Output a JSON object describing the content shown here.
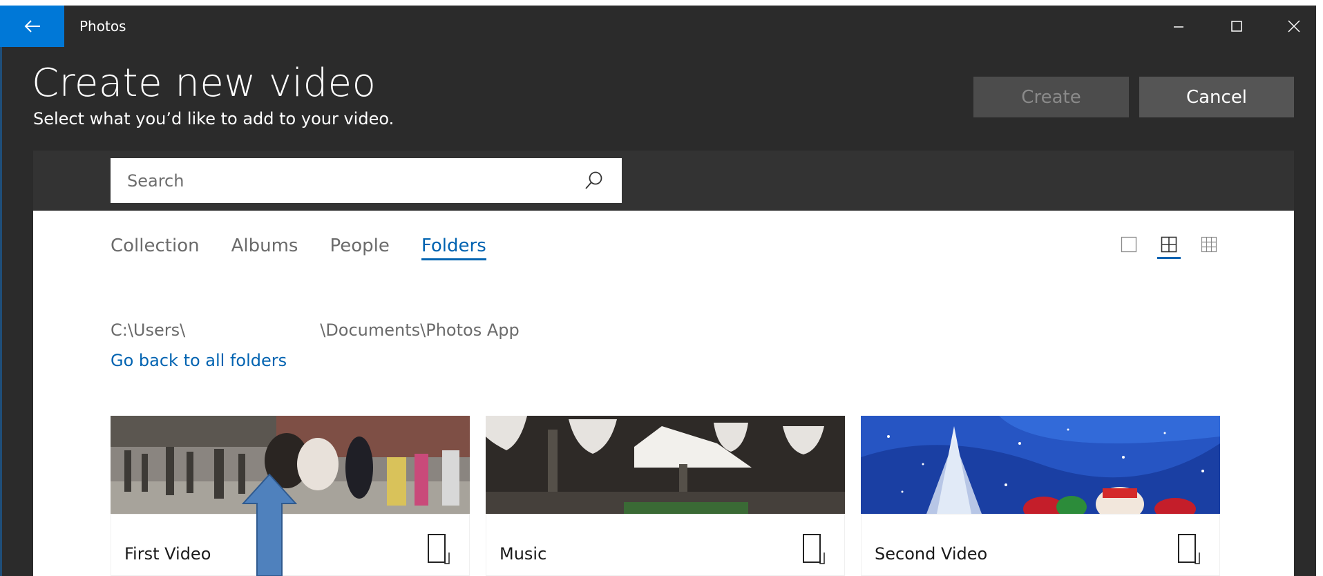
{
  "window": {
    "app_title": "Photos",
    "back_icon": "arrow-left-icon",
    "accent_color": "#0078d7"
  },
  "header": {
    "title": "Create new video",
    "subtitle": "Select what you’d like to add to your video.",
    "create_label": "Create",
    "cancel_label": "Cancel"
  },
  "search": {
    "placeholder": "Search",
    "value": "",
    "icon": "search-icon"
  },
  "tabs": [
    {
      "label": "Collection",
      "active": false
    },
    {
      "label": "Albums",
      "active": false
    },
    {
      "label": "People",
      "active": false
    },
    {
      "label": "Folders",
      "active": true
    }
  ],
  "view_toggles": [
    {
      "icon": "single-view-icon",
      "active": false
    },
    {
      "icon": "grid-4-view-icon",
      "active": true
    },
    {
      "icon": "grid-9-view-icon",
      "active": false
    }
  ],
  "path": {
    "prefix": "C:\\Users\\",
    "suffix": "\\Documents\\Photos App",
    "back_link": "Go back to all folders"
  },
  "folders": [
    {
      "name": "First Video",
      "icon": "folder-icon"
    },
    {
      "name": "Music",
      "icon": "folder-icon"
    },
    {
      "name": "Second Video",
      "icon": "folder-icon"
    }
  ],
  "annotation": {
    "icon": "up-arrow-annotation",
    "color": "#4f81bd"
  }
}
